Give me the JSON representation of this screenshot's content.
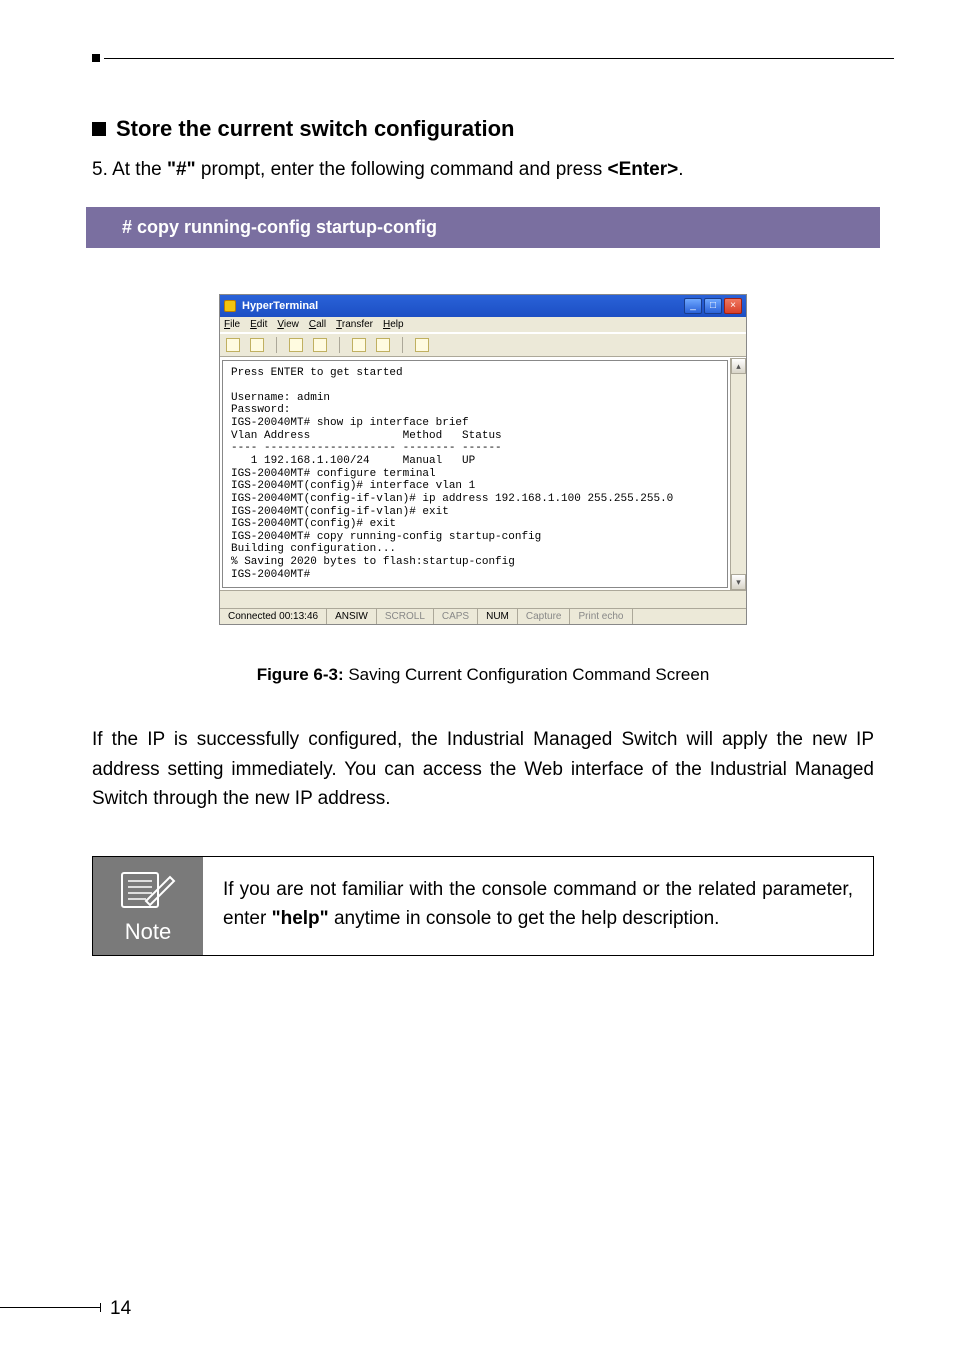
{
  "heading": "Store the current switch configuration",
  "step": {
    "prefix": "5. At the ",
    "prompt": "\"#\"",
    "mid": " prompt, enter the following command and press ",
    "enter": "<Enter>",
    "suffix": "."
  },
  "command_bar": "# copy running-config startup-config",
  "hyperterminal": {
    "title": "HyperTerminal",
    "menus": [
      "File",
      "Edit",
      "View",
      "Call",
      "Transfer",
      "Help"
    ],
    "terminal_text": "Press ENTER to get started\n\nUsername: admin\nPassword:\nIGS-20040MT# show ip interface brief\nVlan Address              Method   Status\n---- -------------------- -------- ------\n   1 192.168.1.100/24     Manual   UP\nIGS-20040MT# configure terminal\nIGS-20040MT(config)# interface vlan 1\nIGS-20040MT(config-if-vlan)# ip address 192.168.1.100 255.255.255.0\nIGS-20040MT(config-if-vlan)# exit\nIGS-20040MT(config)# exit\nIGS-20040MT# copy running-config startup-config\nBuilding configuration...\n% Saving 2020 bytes to flash:startup-config\nIGS-20040MT#",
    "status": {
      "connected": "Connected 00:13:46",
      "emu": "ANSIW",
      "scroll": "SCROLL",
      "caps": "CAPS",
      "num": "NUM",
      "capture": "Capture",
      "printecho": "Print echo"
    }
  },
  "caption": {
    "label": "Figure 6-3:",
    "text": "  Saving Current Configuration Command Screen"
  },
  "paragraph": "If the IP is successfully configured, the Industrial Managed Switch will apply the new IP address setting immediately. You can access the Web interface of the Industrial Managed Switch through the new IP address.",
  "note": {
    "label": "Note",
    "pre": "If you are not familiar with the console command or the related parameter, enter ",
    "help": "\"help\"",
    "post": " anytime in console to get the help description."
  },
  "page_number": "14"
}
